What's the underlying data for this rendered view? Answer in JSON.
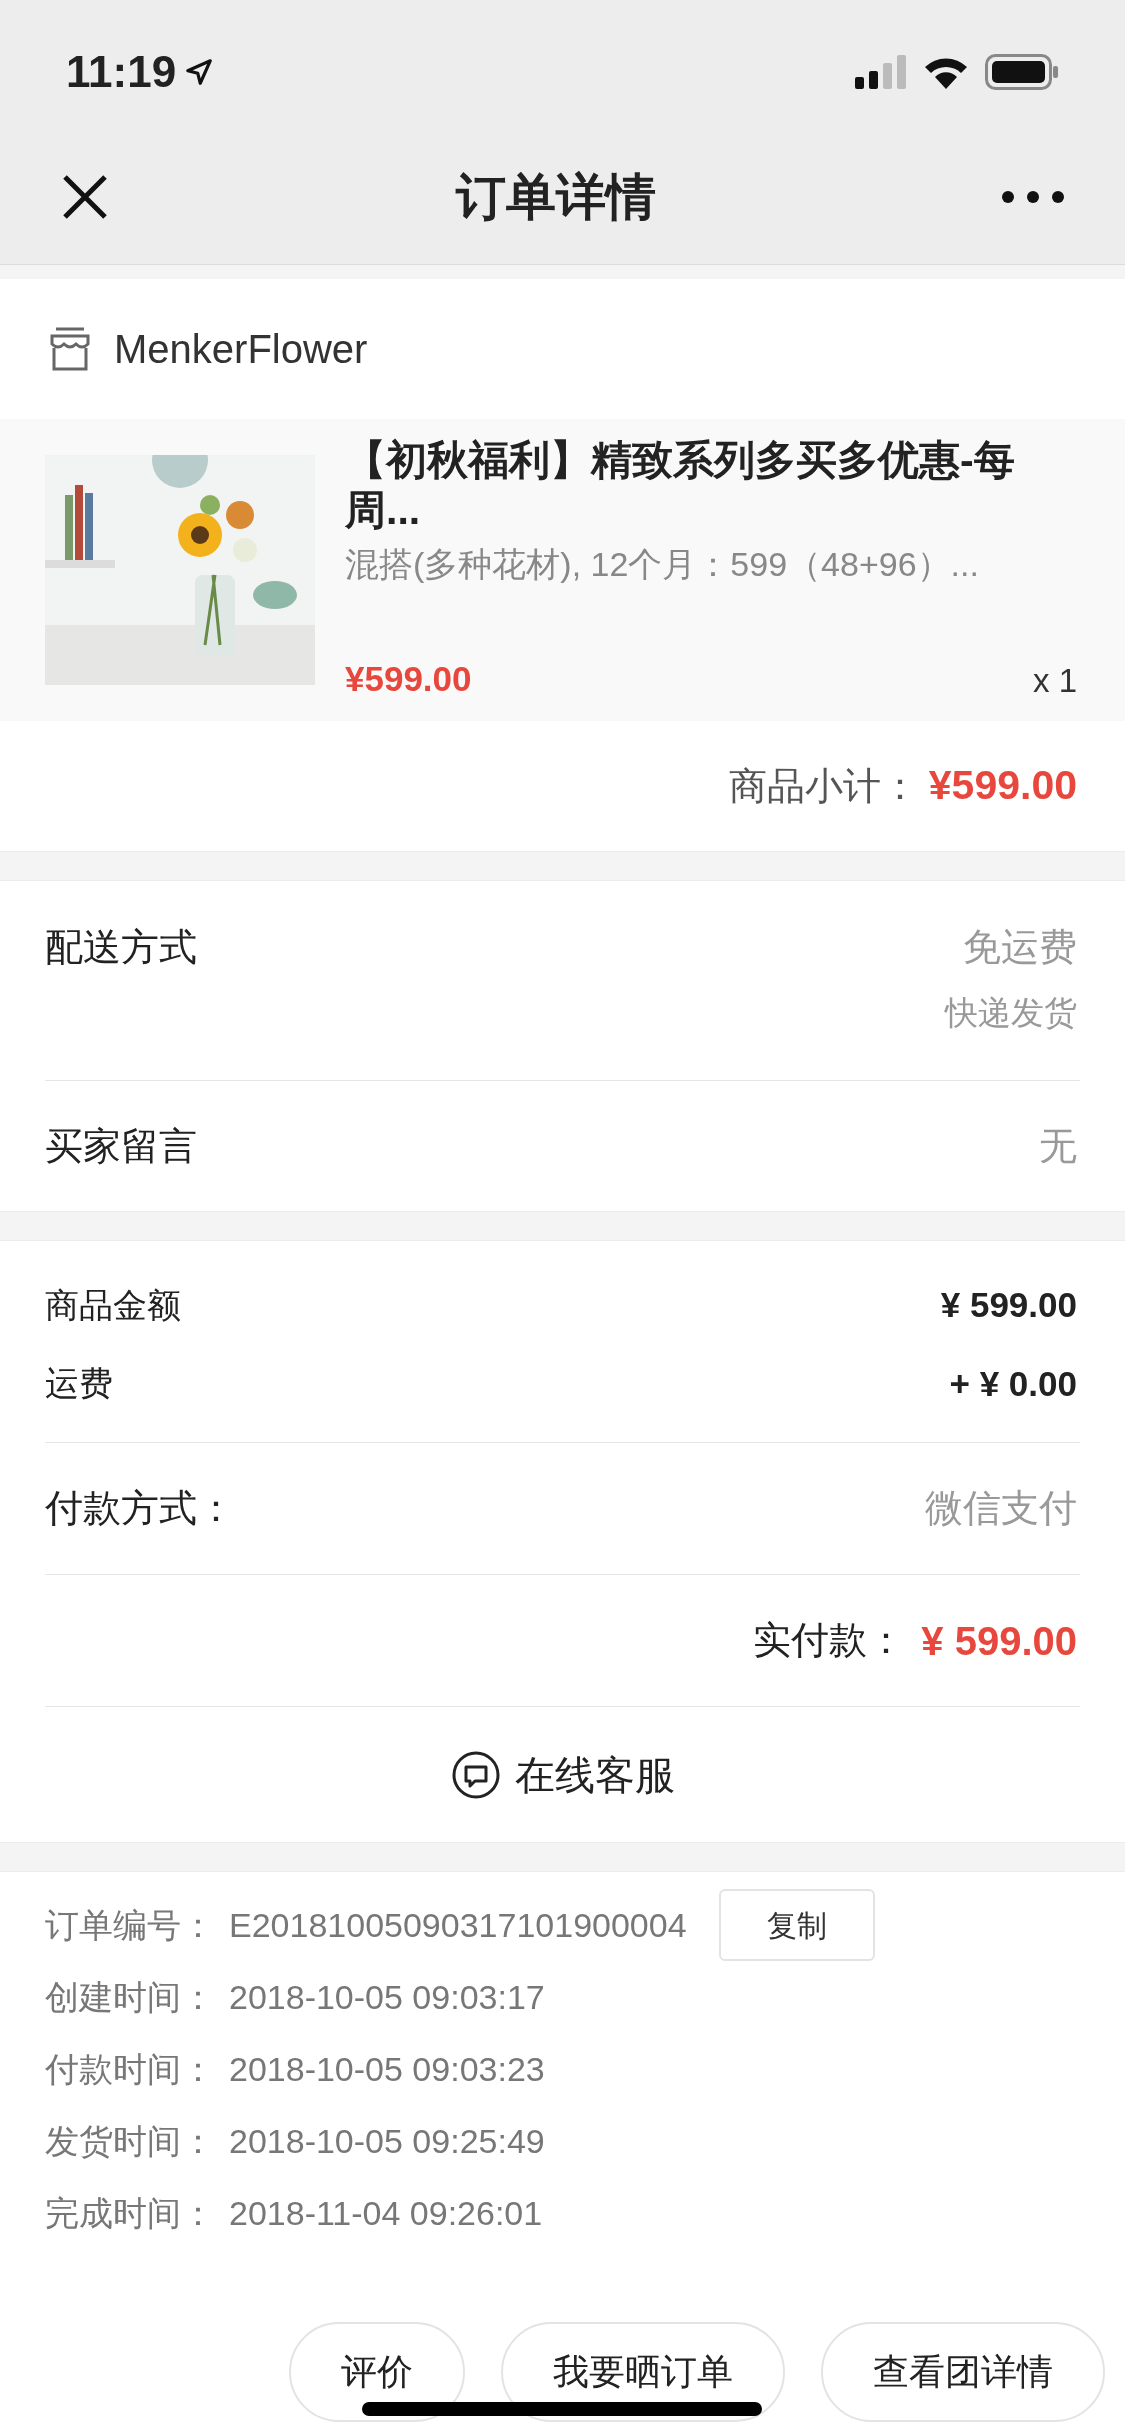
{
  "status_bar": {
    "time": "11:19"
  },
  "nav": {
    "title": "订单详情"
  },
  "shop": {
    "name": "MenkerFlower"
  },
  "product": {
    "kind": "picture",
    "title": "【初秋福利】精致系列多买多优惠-每周...",
    "spec": "混搭(多种花材), 12个月：599（48+96）...",
    "price": "¥599.00",
    "quantity": "x 1"
  },
  "subtotal": {
    "label": "商品小计：",
    "value": "¥599.00"
  },
  "delivery": {
    "label": "配送方式",
    "fee": "免运费",
    "method": "快递发货"
  },
  "message": {
    "label": "买家留言",
    "value": "无"
  },
  "amounts": [
    {
      "label": "商品金额",
      "value": "¥ 599.00"
    },
    {
      "label": "运费",
      "value": "+ ¥ 0.00"
    }
  ],
  "payment": {
    "label": "付款方式：",
    "value": "微信支付"
  },
  "paid": {
    "label": "实付款：",
    "value": "¥ 599.00"
  },
  "service": {
    "label": "在线客服"
  },
  "order_info": [
    {
      "label": "订单编号：",
      "value": "E20181005090317101900004",
      "action": "复制"
    },
    {
      "label": "创建时间：",
      "value": "2018-10-05 09:03:17"
    },
    {
      "label": "付款时间：",
      "value": "2018-10-05 09:03:23"
    },
    {
      "label": "发货时间：",
      "value": "2018-10-05 09:25:49"
    },
    {
      "label": "完成时间：",
      "value": "2018-11-04 09:26:01"
    }
  ],
  "actions": [
    "评价",
    "我要晒订单",
    "查看团详情"
  ]
}
